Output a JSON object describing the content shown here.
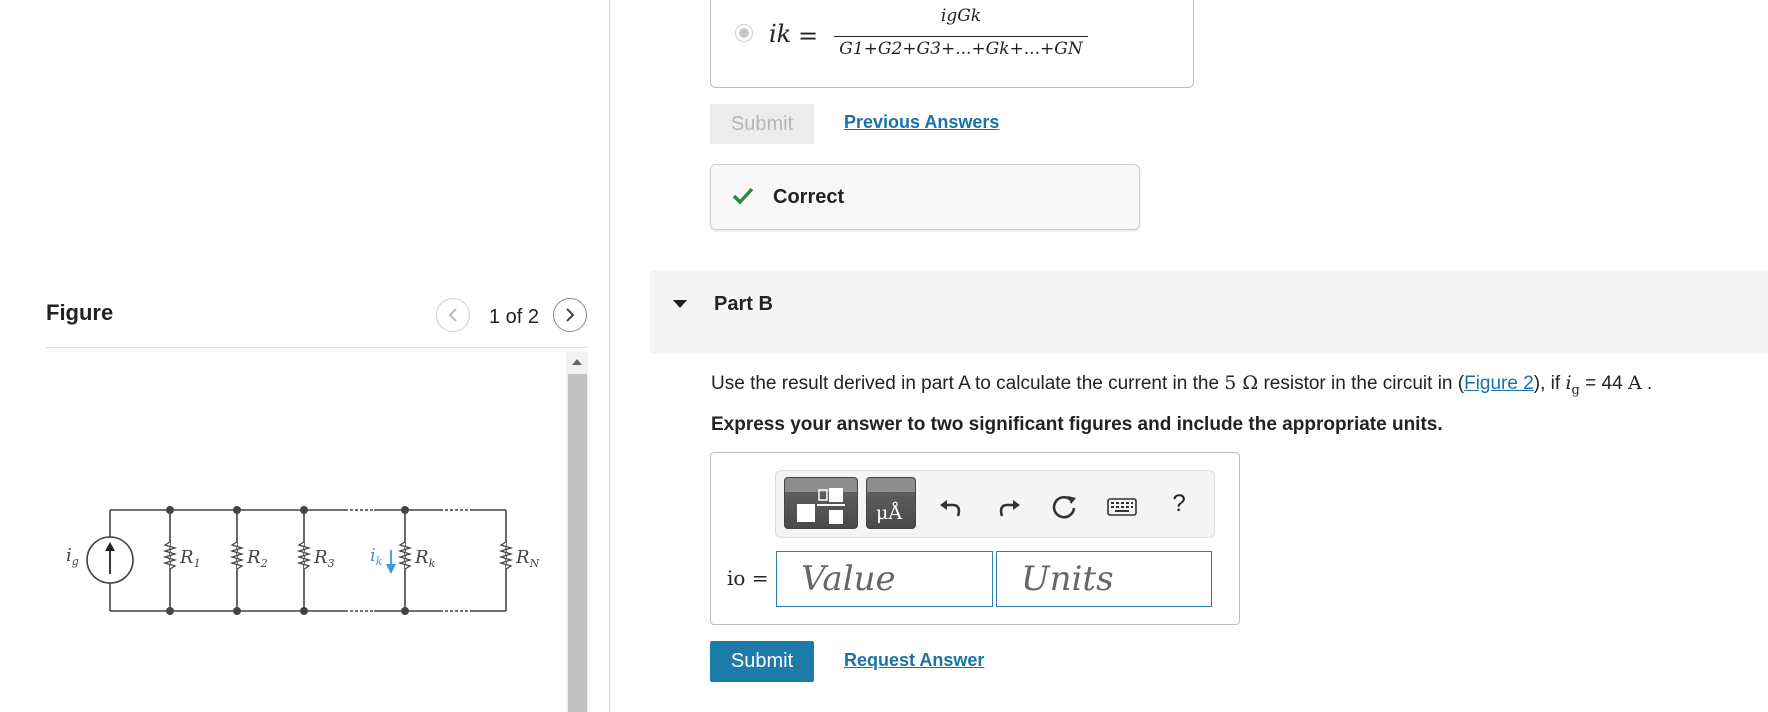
{
  "figure_panel": {
    "title": "Figure",
    "page_indicator": "1 of 2",
    "circuit_labels": {
      "source": "i",
      "source_sub": "g",
      "r1": "R",
      "r1_sub": "1",
      "r2": "R",
      "r2_sub": "2",
      "r3": "R",
      "r3_sub": "3",
      "ik": "i",
      "ik_sub": "k",
      "rk": "R",
      "rk_sub": "k",
      "rn": "R",
      "rn_sub": "N"
    }
  },
  "part_a": {
    "formula_lhs": "ik",
    "formula_eq": "=",
    "formula_numerator": "igGk",
    "formula_denominator": "G1+G2+G3+...+Gk+...+GN",
    "submit_label": "Submit",
    "previous_answers_label": "Previous Answers",
    "feedback": "Correct"
  },
  "part_b": {
    "title": "Part B",
    "question_prefix": "Use the result derived in part A to calculate the current in the",
    "question_resistance": "5 Ω",
    "question_middle": "resistor in the circuit in (",
    "figure_link": "Figure 2",
    "question_after_link": "), if",
    "question_var": "i",
    "question_var_sub": "g",
    "question_value": "= 44",
    "question_unit": "A",
    "question_end": ".",
    "instruction": "Express your answer to two significant figures and include the appropriate units.",
    "toolbar": {
      "units_glyph": "μÅ",
      "help": "?"
    },
    "answer_label": "io =",
    "value_placeholder": "Value",
    "units_placeholder": "Units",
    "submit_label": "Submit",
    "request_answer_label": "Request Answer"
  },
  "colors": {
    "accent": "#1c7ba8",
    "link": "#1a73a8",
    "correct": "#2a8a3e",
    "circuit_current": "#3a9ad9"
  }
}
